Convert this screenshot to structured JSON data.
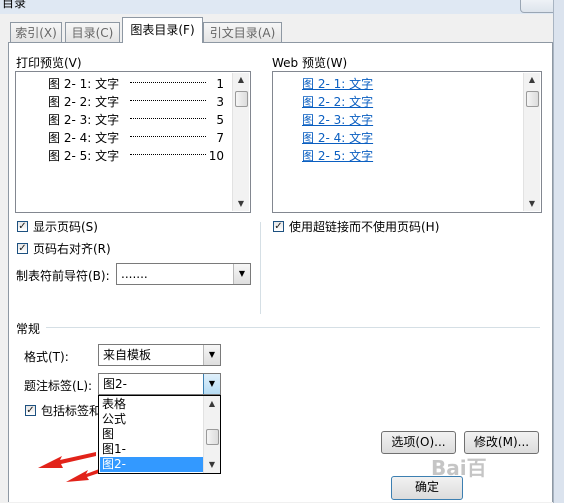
{
  "title_fragment": "目录",
  "tabs": [
    {
      "label": "索引(X)"
    },
    {
      "label": "目录(C)"
    },
    {
      "label": "图表目录(F)"
    },
    {
      "label": "引文目录(A)"
    }
  ],
  "print_preview": {
    "label": "打印预览(V)",
    "rows": [
      {
        "text": "图 2- 1:  文字",
        "page": "1"
      },
      {
        "text": "图 2- 2:  文字",
        "page": "3"
      },
      {
        "text": "图 2- 3:  文字",
        "page": "5"
      },
      {
        "text": "图 2- 4:  文字",
        "page": "7"
      },
      {
        "text": "图 2- 5:  文字",
        "page": "10"
      }
    ]
  },
  "web_preview": {
    "label": "Web 预览(W)",
    "rows": [
      "图 2- 1:  文字",
      "图 2- 2:  文字",
      "图 2- 3:  文字",
      "图 2- 4:  文字",
      "图 2- 5:  文字"
    ]
  },
  "options": {
    "show_page_numbers": {
      "label": "显示页码(S)",
      "checked": true
    },
    "right_align": {
      "label": "页码右对齐(R)",
      "checked": true
    },
    "tab_leader": {
      "label": "制表符前导符(B):",
      "value": "......."
    },
    "use_hyperlinks": {
      "label": "使用超链接而不使用页码(H)",
      "checked": true
    }
  },
  "general": {
    "section_label": "常规",
    "format": {
      "label": "格式(T):",
      "value": "来自模板"
    },
    "caption_label": {
      "label": "题注标签(L):",
      "value": "图2-"
    },
    "include_label": {
      "label": "包括标签和",
      "checked": true
    }
  },
  "caption_dropdown": {
    "items": [
      "表格",
      "公式",
      "图",
      "图1-",
      "图2-"
    ],
    "selected_index": 4
  },
  "buttons": {
    "options": "选项(O)...",
    "modify": "修改(M)...",
    "ok": "确定"
  },
  "watermark": "Bai百"
}
